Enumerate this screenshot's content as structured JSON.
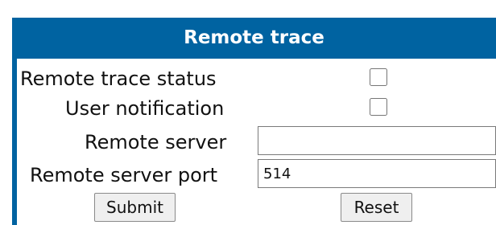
{
  "panel": {
    "title": "Remote trace"
  },
  "form": {
    "remote_trace_status_label": "Remote trace status",
    "remote_trace_status_checked": false,
    "user_notification_label": "User notification",
    "user_notification_checked": false,
    "remote_server_label": "Remote server",
    "remote_server_value": "",
    "remote_server_port_label": "Remote server port",
    "remote_server_port_value": "514"
  },
  "buttons": {
    "submit_label": "Submit",
    "reset_label": "Reset"
  },
  "colors": {
    "header_background": "#0063a1",
    "header_text": "#ffffff"
  }
}
